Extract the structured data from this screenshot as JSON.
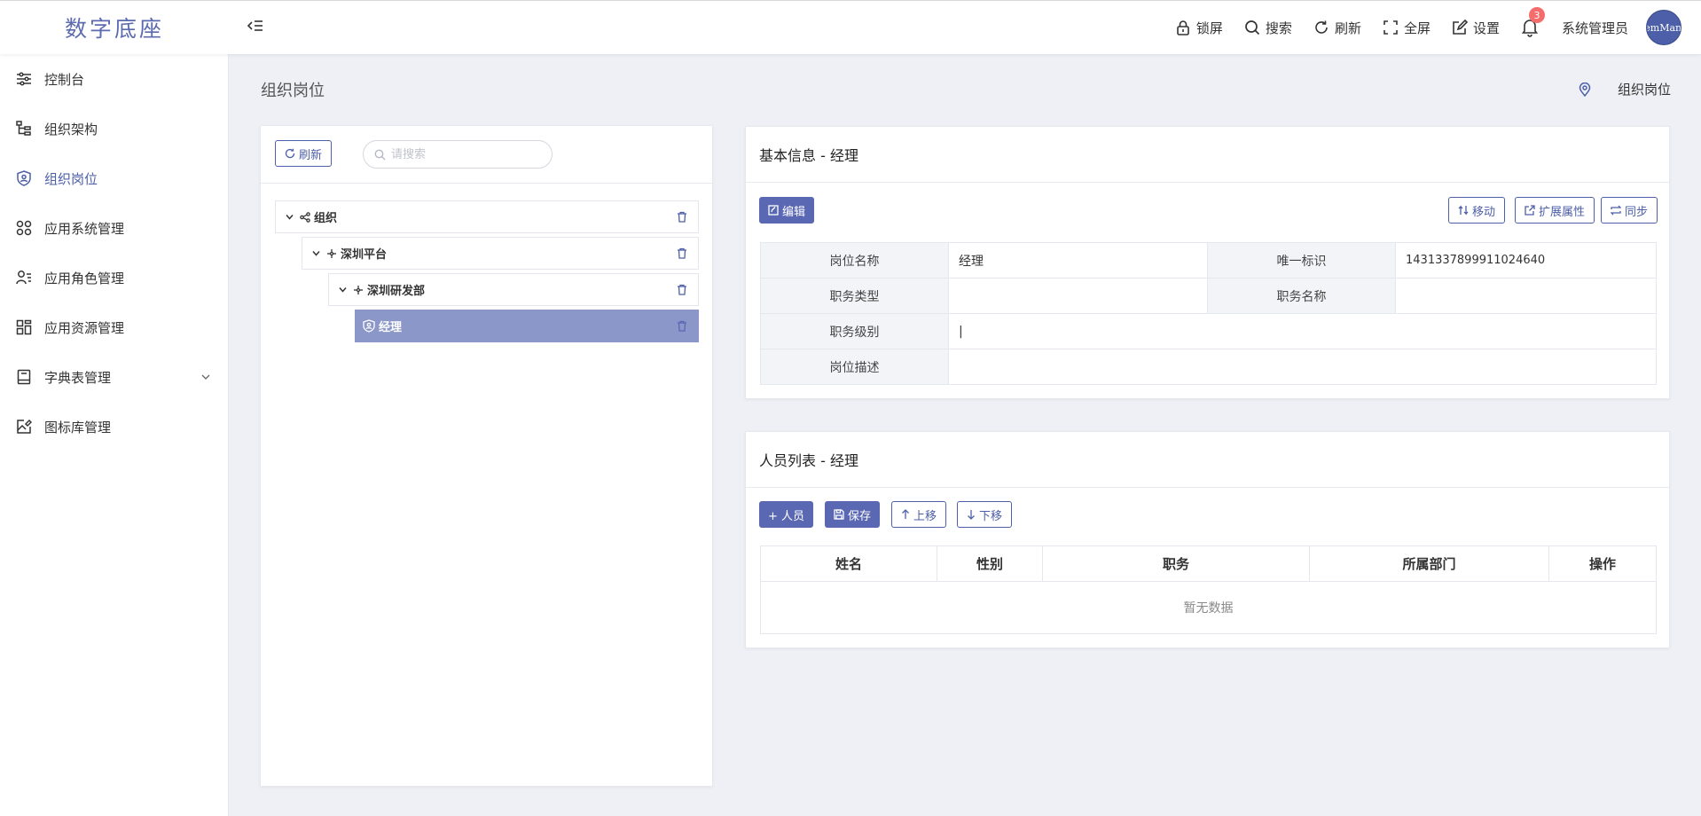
{
  "header": {
    "app_title": "数字底座",
    "tools": {
      "lock": "锁屏",
      "search": "搜索",
      "refresh": "刷新",
      "fullscreen": "全屏",
      "settings": "设置"
    },
    "notification_count": "3",
    "username": "系统管理员",
    "avatar_text": "SystemManager"
  },
  "sidebar": {
    "items": [
      {
        "label": "控制台",
        "icon": "sliders-icon"
      },
      {
        "label": "组织架构",
        "icon": "org-tree-icon"
      },
      {
        "label": "组织岗位",
        "icon": "shield-user-icon",
        "active": true
      },
      {
        "label": "应用系统管理",
        "icon": "apps-icon"
      },
      {
        "label": "应用角色管理",
        "icon": "user-list-icon"
      },
      {
        "label": "应用资源管理",
        "icon": "grid-icon"
      },
      {
        "label": "字典表管理",
        "icon": "book-icon",
        "expandable": true
      },
      {
        "label": "图标库管理",
        "icon": "image-edit-icon"
      }
    ]
  },
  "page": {
    "title": "组织岗位",
    "breadcrumb": "组织岗位"
  },
  "tree_panel": {
    "refresh_label": "刷新",
    "search_placeholder": "请搜索",
    "nodes": [
      {
        "label": "组织",
        "icon": "share-icon"
      },
      {
        "label": "深圳平台",
        "icon": "cluster-icon"
      },
      {
        "label": "深圳研发部",
        "icon": "cluster-icon"
      },
      {
        "label": "经理",
        "icon": "shield-user-icon",
        "selected": true
      }
    ]
  },
  "info_panel": {
    "title": "基本信息 - 经理",
    "edit_label": "编辑",
    "move_label": "移动",
    "ext_label": "扩展属性",
    "sync_label": "同步",
    "fields": {
      "post_name_label": "岗位名称",
      "post_name_value": "经理",
      "uid_label": "唯一标识",
      "uid_value": "1431337899911024640",
      "job_type_label": "职务类型",
      "job_type_value": "",
      "job_name_label": "职务名称",
      "job_name_value": "",
      "job_level_label": "职务级别",
      "job_level_value": "|",
      "desc_label": "岗位描述",
      "desc_value": ""
    }
  },
  "member_panel": {
    "title": "人员列表 - 经理",
    "add_label": "+ 人员",
    "save_label": "保存",
    "up_label": "上移",
    "down_label": "下移",
    "columns": [
      "姓名",
      "性别",
      "职务",
      "所属部门",
      "操作"
    ],
    "empty_text": "暂无数据"
  },
  "colors": {
    "accent": "#4d5fa8",
    "selected_node": "#8b97c9",
    "page_bg": "#eef0f6"
  }
}
